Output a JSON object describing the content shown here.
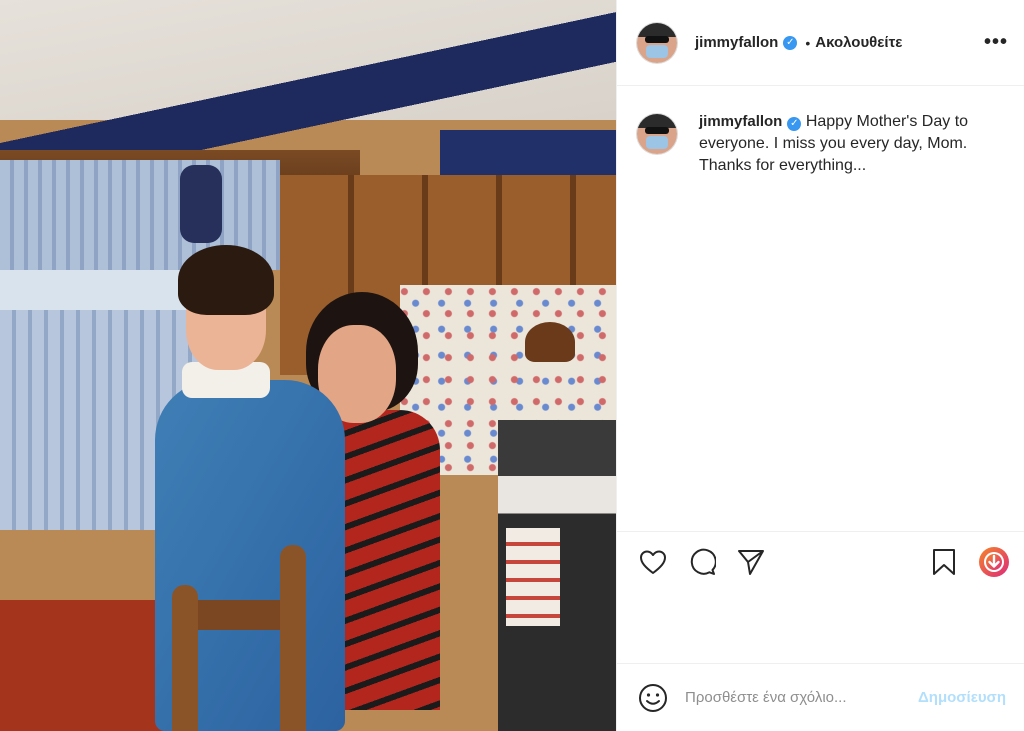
{
  "post": {
    "photo": {
      "alt": ""
    },
    "header": {
      "username": "jimmyfallon",
      "verified_icon": "verified-badge-icon",
      "separator": "•",
      "follow_label": "Ακολουθείτε",
      "more_label": "•••"
    },
    "caption": {
      "username": "jimmyfallon",
      "text": "Happy Mother's Day to everyone. I miss you every day, Mom. Thanks for everything..."
    },
    "actions": {
      "icons": [
        "heart-icon",
        "comment-icon",
        "share-icon",
        "bookmark-icon",
        "extension-download-icon"
      ]
    },
    "comment_box": {
      "placeholder": "Προσθέστε ένα σχόλιο...",
      "post_label": "Δημοσίευση",
      "emoji_icon": "emoji-icon"
    },
    "colors": {
      "verified": "#3897f0",
      "post_button_disabled": "#b2dffc",
      "extension_gradient_start": "#f58529",
      "extension_gradient_end": "#dd2a7b"
    }
  }
}
